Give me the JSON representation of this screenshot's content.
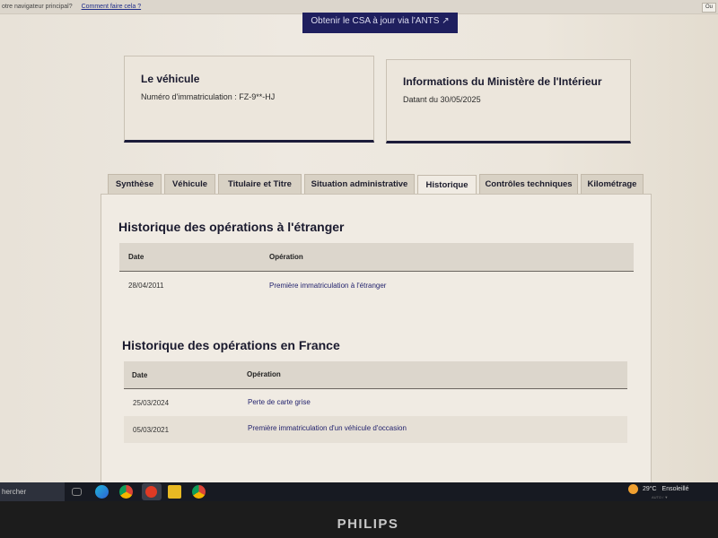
{
  "notification": {
    "text": "otre navigateur principal?",
    "link": "Comment faire cela ?",
    "close_label": "Ou"
  },
  "csa_button": {
    "label": "Obtenir le CSA à jour via l'ANTS ↗"
  },
  "vehicle_card": {
    "title": "Le véhicule",
    "registration": "Numéro d'immatriculation : FZ-9**-HJ"
  },
  "ministry_card": {
    "title": "Informations du Ministère de l'Intérieur",
    "date": "Datant du 30/05/2025"
  },
  "tabs": [
    {
      "label": "Synthèse",
      "active": false
    },
    {
      "label": "Véhicule",
      "active": false
    },
    {
      "label": "Titulaire et Titre",
      "active": false
    },
    {
      "label": "Situation administrative",
      "active": false
    },
    {
      "label": "Historique",
      "active": true
    },
    {
      "label": "Contrôles techniques",
      "active": false
    },
    {
      "label": "Kilométrage",
      "active": false
    }
  ],
  "foreign_history": {
    "title": "Historique des opérations à l'étranger",
    "columns": {
      "date": "Date",
      "operation": "Opération"
    },
    "rows": [
      {
        "date": "28/04/2011",
        "operation": "Première immatriculation à l'étranger"
      }
    ]
  },
  "france_history": {
    "title": "Historique des opérations en France",
    "columns": {
      "date": "Date",
      "operation": "Opération"
    },
    "rows": [
      {
        "date": "25/03/2024",
        "operation": "Perte de carte grise"
      },
      {
        "date": "05/03/2021",
        "operation": "Première immatriculation d'un véhicule d'occasion"
      }
    ]
  },
  "taskbar": {
    "search_text": "hercher",
    "weather_temp": "29°C",
    "weather_desc": "Ensoleillé",
    "tray_text": "AUTO / ▼"
  },
  "monitor_brand": "PHILIPS",
  "colors": {
    "primary_navy": "#1f1f5e",
    "link_blue": "#23236e",
    "card_border": "#1c1c3a",
    "taskbar": "#171a22"
  }
}
